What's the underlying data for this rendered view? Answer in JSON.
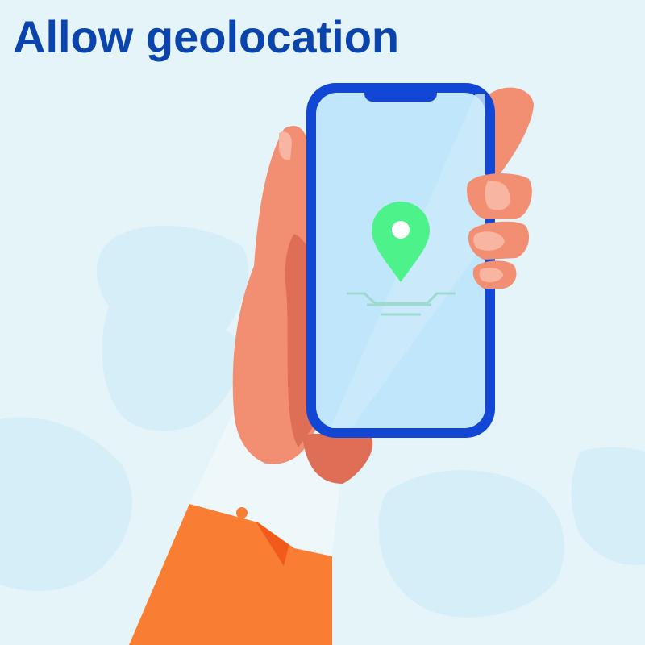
{
  "heading": {
    "title": "Allow geolocation"
  },
  "illustration": {
    "subject": "hand-holding-phone",
    "screen_icon": "map-pin-icon",
    "background_decor": "monstera-leaf-icon"
  },
  "colors": {
    "background": "#e5f4f8",
    "leaf": "#d6eef8",
    "title": "#0b44ad",
    "phone_frame": "#1247d6",
    "phone_screen": "#bfe6fa",
    "pin": "#4ef28a",
    "skin": "#f28e72",
    "skin_shadow": "#de6e55",
    "sleeve": "#f97e33",
    "cuff": "#eef7fa"
  }
}
